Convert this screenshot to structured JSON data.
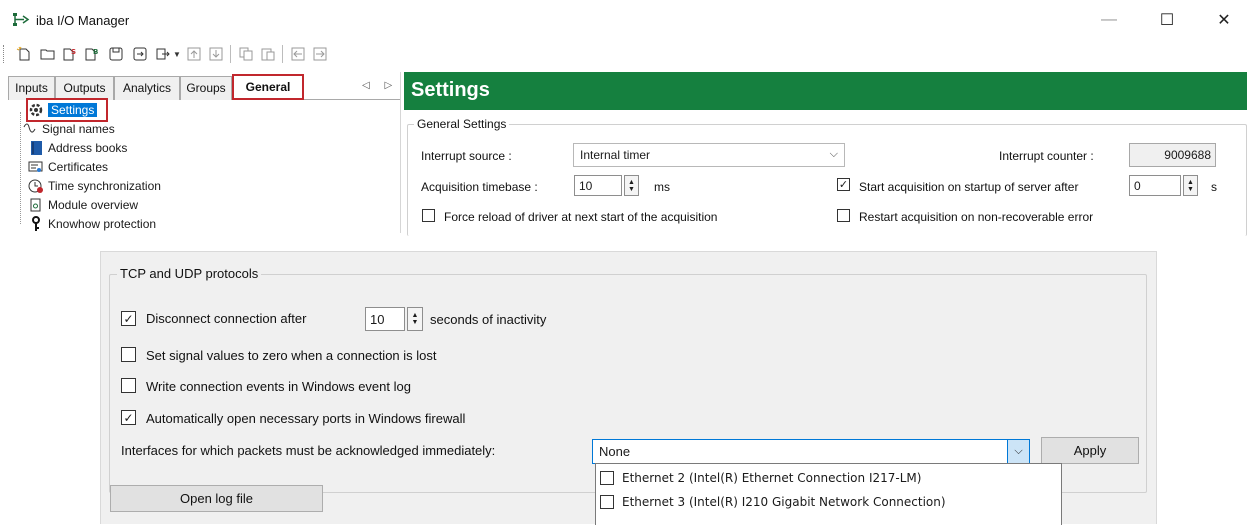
{
  "window": {
    "title": "iba I/O Manager",
    "min_glyph": "—",
    "max_glyph": "☐",
    "close_glyph": "✕"
  },
  "tabs": [
    {
      "label": "Inputs"
    },
    {
      "label": "Outputs"
    },
    {
      "label": "Analytics"
    },
    {
      "label": "Groups"
    },
    {
      "label": "General",
      "active": true
    }
  ],
  "tab_scroll": "◁ ▷",
  "tree": [
    {
      "label": "Settings",
      "icon": "gear-icon",
      "selected": true
    },
    {
      "label": "Signal names",
      "icon": "signal-icon"
    },
    {
      "label": "Address books",
      "icon": "book-icon"
    },
    {
      "label": "Certificates",
      "icon": "certificate-icon"
    },
    {
      "label": "Time synchronization",
      "icon": "clock-icon"
    },
    {
      "label": "Module overview",
      "icon": "module-icon"
    },
    {
      "label": "Knowhow protection",
      "icon": "key-icon"
    }
  ],
  "settings": {
    "title": "Settings",
    "general_group": "General Settings",
    "interrupt_source_label": "Interrupt source :",
    "interrupt_source_value": "Internal timer",
    "interrupt_counter_label": "Interrupt counter :",
    "interrupt_counter_value": "9009688",
    "timebase_label": "Acquisition timebase :",
    "timebase_value": "10",
    "timebase_unit": "ms",
    "start_on_startup_label": "Start acquisition on startup of server after",
    "start_on_startup_checked": true,
    "start_delay_value": "0",
    "start_delay_unit": "s",
    "force_reload_label": "Force reload of driver at next start of the acquisition",
    "force_reload_checked": false,
    "restart_label": "Restart acquisition on non-recoverable error",
    "restart_checked": false
  },
  "tcp": {
    "group_title": "TCP and UDP protocols",
    "disconnect_label": "Disconnect connection after",
    "disconnect_checked": true,
    "disconnect_value": "10",
    "disconnect_suffix": "seconds of inactivity",
    "zero_label": "Set signal values to zero when a connection is lost",
    "zero_checked": false,
    "events_label": "Write connection events in Windows event log",
    "events_checked": false,
    "firewall_label": "Automatically open necessary ports in Windows firewall",
    "firewall_checked": true,
    "interfaces_label": "Interfaces for which packets must be acknowledged immediately:",
    "interfaces_value": "None",
    "apply_label": "Apply",
    "dropdown_options": [
      {
        "label": "Ethernet 2 (Intel(R) Ethernet Connection I217-LM)",
        "checked": false
      },
      {
        "label": "Ethernet 3 (Intel(R) I210 Gigabit Network Connection)",
        "checked": false
      }
    ],
    "open_log_label": "Open log file"
  },
  "colors": {
    "header_green": "#15803f",
    "highlight_red": "#c1272d",
    "selection_blue": "#0078d7"
  }
}
